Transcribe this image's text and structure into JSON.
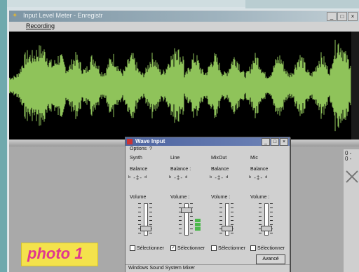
{
  "window": {
    "title": "Input Level Meter - Enregistr",
    "menu_recording": "Recording",
    "btn_min": "_",
    "btn_max": "□",
    "btn_close": "×"
  },
  "waveform": {
    "color": "#8fc35a",
    "background": "#000000"
  },
  "dialog": {
    "title": "Wave Input",
    "menu_options": "Options",
    "menu_extra": "?",
    "channels": [
      {
        "name": "Synth",
        "balance_label": "Balance",
        "volume_label": "Volume",
        "select_label": "Sélectionner",
        "selected": false,
        "volume_level": 0.15,
        "meter": false
      },
      {
        "name": "Line",
        "balance_label": "Balance :",
        "volume_label": "Volume :",
        "select_label": "Sélectionner",
        "selected": true,
        "volume_level": 0.85,
        "meter": true
      },
      {
        "name": "MixOut",
        "balance_label": "Balance",
        "volume_label": "Volume :",
        "select_label": "Sélectionner",
        "selected": false,
        "volume_level": 0.15,
        "meter": false
      },
      {
        "name": "Mic",
        "balance_label": "Balance",
        "volume_label": "Volume :",
        "select_label": "Sélectionner",
        "selected": false,
        "volume_level": 0.15,
        "meter": false
      }
    ],
    "advanced_button": "Avancé",
    "status": "Windows Sound System Mixer"
  },
  "right_panel": {
    "label_top": "0 -",
    "label_mid": "0 -"
  },
  "photo_label": "photo 1",
  "colors": {
    "title_gradient_start": "#7d95a4",
    "dialog_title": "#4d64a0",
    "photo_label_bg": "#f4e24c",
    "photo_label_text": "#e0378f"
  }
}
